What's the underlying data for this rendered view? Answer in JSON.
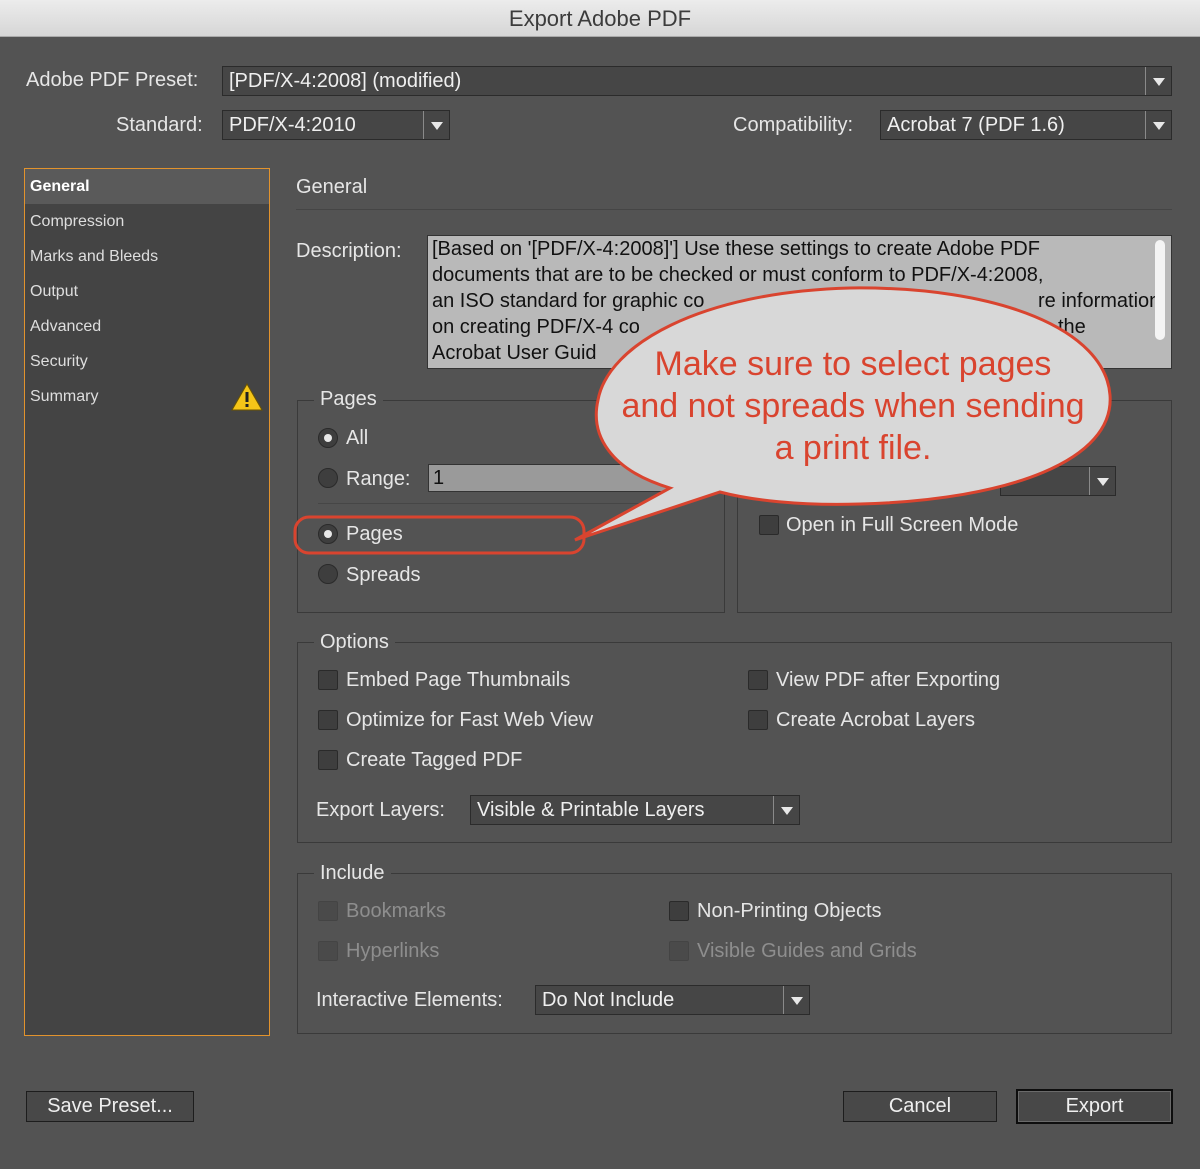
{
  "window": {
    "title": "Export Adobe PDF"
  },
  "preset": {
    "label": "Adobe PDF Preset:",
    "value": "[PDF/X-4:2008] (modified)"
  },
  "standard": {
    "label": "Standard:",
    "value": "PDF/X-4:2010"
  },
  "compatibility": {
    "label": "Compatibility:",
    "value": "Acrobat 7 (PDF 1.6)"
  },
  "sidebar": {
    "items": [
      {
        "label": "General",
        "active": true
      },
      {
        "label": "Compression"
      },
      {
        "label": "Marks and Bleeds"
      },
      {
        "label": "Output"
      },
      {
        "label": "Advanced"
      },
      {
        "label": "Security"
      },
      {
        "label": "Summary",
        "icon": "warning-icon"
      }
    ]
  },
  "main": {
    "section_title": "General",
    "description_label": "Description:",
    "description_lines": [
      "[Based on '[PDF/X-4:2008]'] Use these settings to create Adobe PDF",
      "documents that are to be checked or must conform to PDF/X-4:2008,",
      "an ISO standard for graphic co",
      "on creating PDF/X-4 co",
      "Acrobat User Guid"
    ],
    "description_line3_tail": "re information",
    "description_line4_tail": "the"
  },
  "pages": {
    "title": "Pages",
    "all_label": "All",
    "range_label": "Range:",
    "range_value": "1",
    "pages_label": "Pages",
    "spreads_label": "Spreads"
  },
  "viewing": {
    "fullscreen_label": "Open in Full Screen Mode"
  },
  "options": {
    "title": "Options",
    "embed_thumbnails": "Embed Page Thumbnails",
    "optimize_web": "Optimize for Fast Web View",
    "tagged_pdf": "Create Tagged PDF",
    "view_after": "View PDF after Exporting",
    "acrobat_layers": "Create Acrobat Layers",
    "export_layers_label": "Export Layers:",
    "export_layers_value": "Visible & Printable Layers"
  },
  "include": {
    "title": "Include",
    "bookmarks": "Bookmarks",
    "hyperlinks": "Hyperlinks",
    "non_printing": "Non-Printing Objects",
    "guides_grids": "Visible Guides and Grids",
    "interactive_label": "Interactive Elements:",
    "interactive_value": "Do Not Include"
  },
  "buttons": {
    "save_preset": "Save Preset...",
    "cancel": "Cancel",
    "export": "Export"
  },
  "callout": {
    "lines": [
      "Make sure to select pages",
      "and not spreads when sending",
      "a print file."
    ],
    "color": "#d9442f"
  }
}
